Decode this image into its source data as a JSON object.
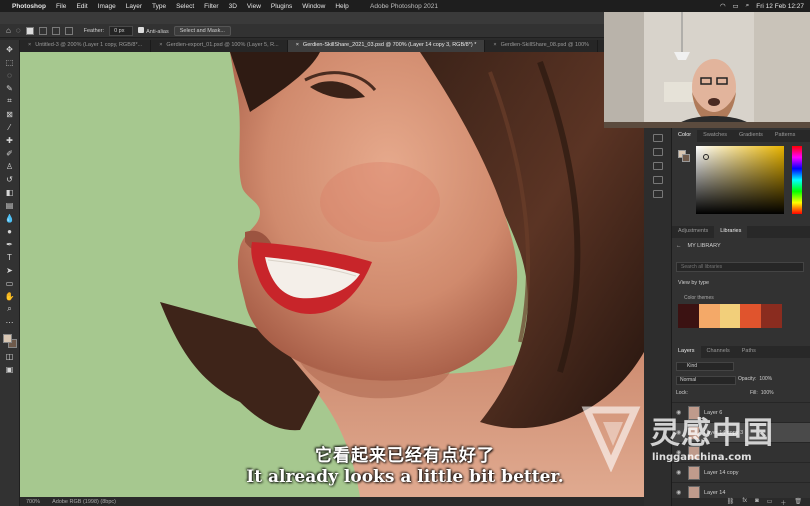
{
  "menubar": {
    "app": "Photoshop",
    "items": [
      "File",
      "Edit",
      "Image",
      "Layer",
      "Type",
      "Select",
      "Filter",
      "3D",
      "View",
      "Plugins",
      "Window",
      "Help"
    ],
    "window_title": "Adobe Photoshop 2021",
    "clock": "Fri 12 Feb  12:27"
  },
  "options_bar": {
    "feather_label": "Feather:",
    "feather_value": "0 px",
    "anti_alias_label": "Anti-alias",
    "select_mask_label": "Select and Mask..."
  },
  "tabs": [
    {
      "label": "Untitled-3 @ 200% (Layer 1 copy, RGB/8*...",
      "active": false
    },
    {
      "label": "Gerdien-export_01.psd @ 100% (Layer 5, R...",
      "active": false
    },
    {
      "label": "Gerdien-SkillShare_2021_03.psd @ 700% (Layer 14 copy 3, RGB/8*) *",
      "active": true
    },
    {
      "label": "Gerdien-SkillShare_08.psd @ 100%",
      "active": false
    }
  ],
  "status_bar": {
    "zoom": "700%",
    "profile": "Adobe RGB (1998) (8bpc)"
  },
  "subtitles": {
    "chinese": "它看起来已经有点好了",
    "english": "It already looks a little bit better."
  },
  "color_panel": {
    "tabs": [
      "Color",
      "Swatches",
      "Gradients",
      "Patterns"
    ]
  },
  "libraries_panel": {
    "tabs": [
      "Adjustments",
      "Libraries"
    ],
    "library_name": "MY LIBRARY",
    "search_placeholder": "Search all libraries",
    "view_by": "View by type",
    "section": "Color themes",
    "theme_colors": [
      "#3b1212",
      "#f4a968",
      "#f2cf7a",
      "#e0542d",
      "#8a2c1f"
    ]
  },
  "layers_panel": {
    "tabs": [
      "Layers",
      "Channels",
      "Paths"
    ],
    "kind_label": "Kind",
    "blend_mode": "Normal",
    "opacity_label": "Opacity:",
    "opacity_value": "100%",
    "lock_label": "Lock:",
    "fill_label": "Fill:",
    "fill_value": "100%",
    "layers": [
      {
        "name": "Layer 6",
        "selected": false
      },
      {
        "name": "Layer 14 copy 3",
        "selected": true
      },
      {
        "name": "",
        "selected": false
      },
      {
        "name": "Layer 14 copy",
        "selected": false
      },
      {
        "name": "Layer 14",
        "selected": false
      }
    ]
  },
  "watermark": {
    "brand": "灵感中国",
    "url": "lingganchina.com"
  },
  "colors": {
    "canvas_bg": "#a6c88f",
    "ui_dark": "#323232",
    "accent_red": "#c8252a"
  }
}
